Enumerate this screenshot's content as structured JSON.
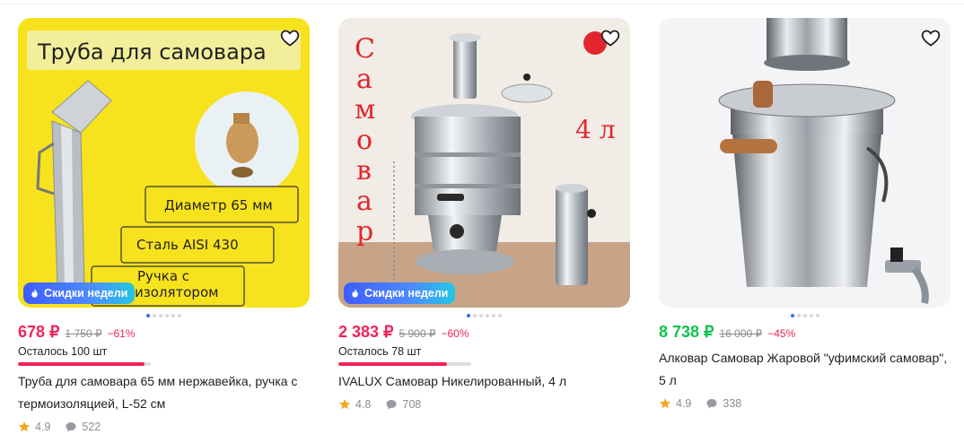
{
  "products": [
    {
      "price": "678 ₽",
      "old_price": "1 750 ₽",
      "discount": "−61%",
      "stock_label": "Осталось 100 шт",
      "stock_fill": 0.95,
      "title": "Труба для самовара 65 мм нержавейка, ручка с термоизоляцией, L-52 см",
      "rating": "4.9",
      "reviews": "522",
      "badge": "Скидки недели",
      "image_text": {
        "headline": "Труба для самовара",
        "spec1": "Диаметр 65 мм",
        "spec2": "Сталь AISI 430",
        "spec3a": "Ручка с",
        "spec3b": "изолятором"
      }
    },
    {
      "price": "2 383 ₽",
      "old_price": "5 900 ₽",
      "discount": "−60%",
      "stock_label": "Осталось 78 шт",
      "stock_fill": 0.82,
      "title": "IVALUX Самовар Никелированный, 4 л",
      "rating": "4.8",
      "reviews": "708",
      "badge": "Скидки недели",
      "image_text": {
        "vertical": [
          "С",
          "а",
          "м",
          "о",
          "в",
          "а",
          "р"
        ],
        "volume": "4 л"
      }
    },
    {
      "price": "8 738 ₽",
      "old_price": "16 000 ₽",
      "discount": "−45%",
      "title": "Алковар Самовар Жаровой \"уфимский самовар\", 5 л",
      "rating": "4.9",
      "reviews": "338"
    }
  ],
  "colors": {
    "price_red": "#f0245a",
    "price_green": "#10c44c",
    "badge_blue": "#3d5cff",
    "star": "#f5a623"
  },
  "icons": [
    "heart-icon",
    "fire-icon",
    "star-icon",
    "comment-icon"
  ]
}
